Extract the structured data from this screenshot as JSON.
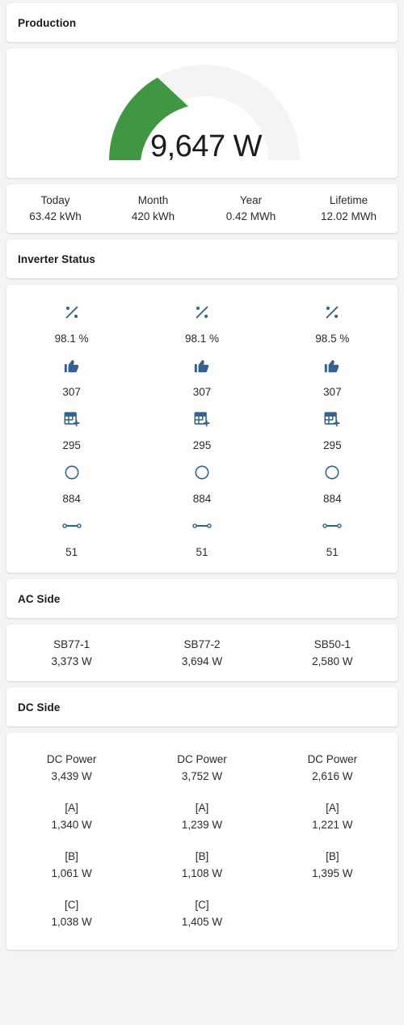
{
  "sections": {
    "production": {
      "title": "Production"
    },
    "inverter_status": {
      "title": "Inverter Status"
    },
    "ac_side": {
      "title": "AC Side"
    },
    "dc_side": {
      "title": "DC Side"
    }
  },
  "gauge": {
    "value_text": "9,647 W",
    "value": 9647,
    "unit": "W",
    "percent": 33,
    "track_color": "#f4f4f4",
    "fill_color": "#419643"
  },
  "energy_stats": [
    {
      "label": "Today",
      "value": "63.42 kWh"
    },
    {
      "label": "Month",
      "value": "420 kWh"
    },
    {
      "label": "Year",
      "value": "0.42 MWh"
    },
    {
      "label": "Lifetime",
      "value": "12.02 MWh"
    }
  ],
  "inverter_status": {
    "icon_color": "#34618f",
    "rows": [
      {
        "icon": "percent-icon",
        "values": [
          "98.1 %",
          "98.1 %",
          "98.5 %"
        ]
      },
      {
        "icon": "thumbs-up-icon",
        "values": [
          "307",
          "307",
          "307"
        ]
      },
      {
        "icon": "table-plus-icon",
        "values": [
          "295",
          "295",
          "295"
        ]
      },
      {
        "icon": "circle-outline-icon",
        "values": [
          "884",
          "884",
          "884"
        ]
      },
      {
        "icon": "connection-icon",
        "values": [
          "51",
          "51",
          "51"
        ]
      }
    ]
  },
  "ac_side": {
    "columns": [
      {
        "name": "SB77-1",
        "power": "3,373 W"
      },
      {
        "name": "SB77-2",
        "power": "3,694 W"
      },
      {
        "name": "SB50-1",
        "power": "2,580 W"
      }
    ]
  },
  "dc_side": {
    "columns": [
      {
        "groups": [
          {
            "label": "DC Power",
            "value": "3,439 W"
          },
          {
            "label": "[A]",
            "value": "1,340 W"
          },
          {
            "label": "[B]",
            "value": "1,061 W"
          },
          {
            "label": "[C]",
            "value": "1,038 W"
          }
        ]
      },
      {
        "groups": [
          {
            "label": "DC Power",
            "value": "3,752 W"
          },
          {
            "label": "[A]",
            "value": "1,239 W"
          },
          {
            "label": "[B]",
            "value": "1,108 W"
          },
          {
            "label": "[C]",
            "value": "1,405 W"
          }
        ]
      },
      {
        "groups": [
          {
            "label": "DC Power",
            "value": "2,616 W"
          },
          {
            "label": "[A]",
            "value": "1,221 W"
          },
          {
            "label": "[B]",
            "value": "1,395 W"
          }
        ]
      }
    ]
  }
}
